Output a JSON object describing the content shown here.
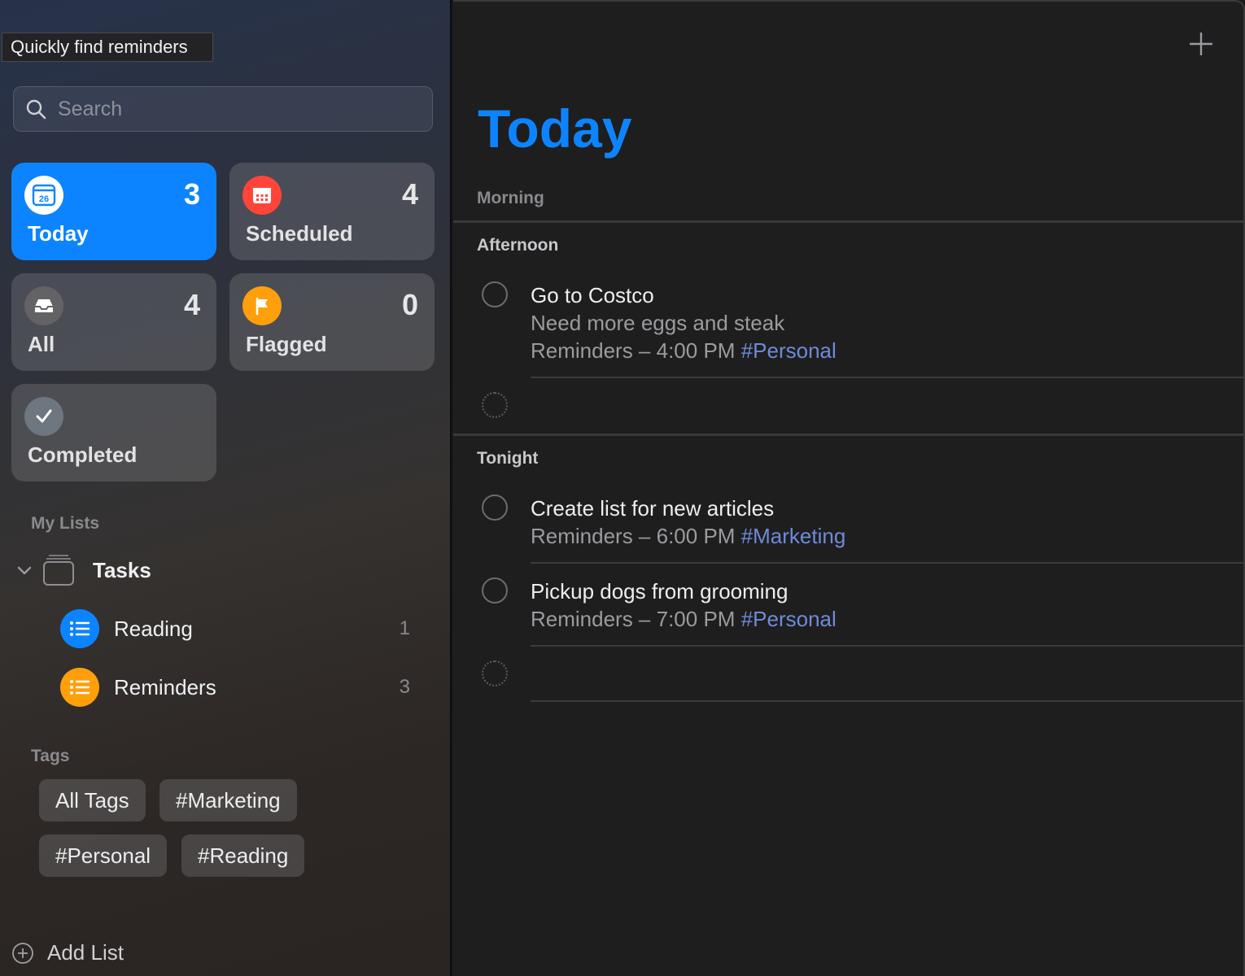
{
  "tooltip": "Quickly find reminders",
  "search": {
    "placeholder": "Search"
  },
  "smart_lists": {
    "today": {
      "label": "Today",
      "count": "3",
      "date": "26"
    },
    "scheduled": {
      "label": "Scheduled",
      "count": "4"
    },
    "all": {
      "label": "All",
      "count": "4"
    },
    "flagged": {
      "label": "Flagged",
      "count": "0"
    },
    "completed": {
      "label": "Completed"
    }
  },
  "my_lists": {
    "title": "My Lists",
    "group": {
      "label": "Tasks"
    },
    "items": [
      {
        "label": "Reading",
        "count": "1",
        "color": "#0d84ff"
      },
      {
        "label": "Reminders",
        "count": "3",
        "color": "#ff9f0a"
      }
    ]
  },
  "tags": {
    "title": "Tags",
    "items": [
      "All Tags",
      "#Marketing",
      "#Personal",
      "#Reading"
    ]
  },
  "add_list": "Add List",
  "main": {
    "title": "Today",
    "sections": {
      "morning": "Morning",
      "afternoon": "Afternoon",
      "tonight": "Tonight"
    },
    "tasks": [
      {
        "title": "Go to Costco",
        "note": "Need more eggs and steak",
        "meta": "Reminders – 4:00 PM",
        "tag": "#Personal"
      },
      {
        "title": "Create list for new articles",
        "meta": "Reminders – 6:00 PM",
        "tag": "#Marketing"
      },
      {
        "title": "Pickup dogs from grooming",
        "meta": "Reminders – 7:00 PM",
        "tag": "#Personal"
      }
    ]
  },
  "colors": {
    "accent": "#0d84ff",
    "scheduled": "#ff453a",
    "flagged": "#ff9f0a",
    "all": "#636366",
    "completed": "#636366",
    "tag_link": "#6e8bd8"
  }
}
